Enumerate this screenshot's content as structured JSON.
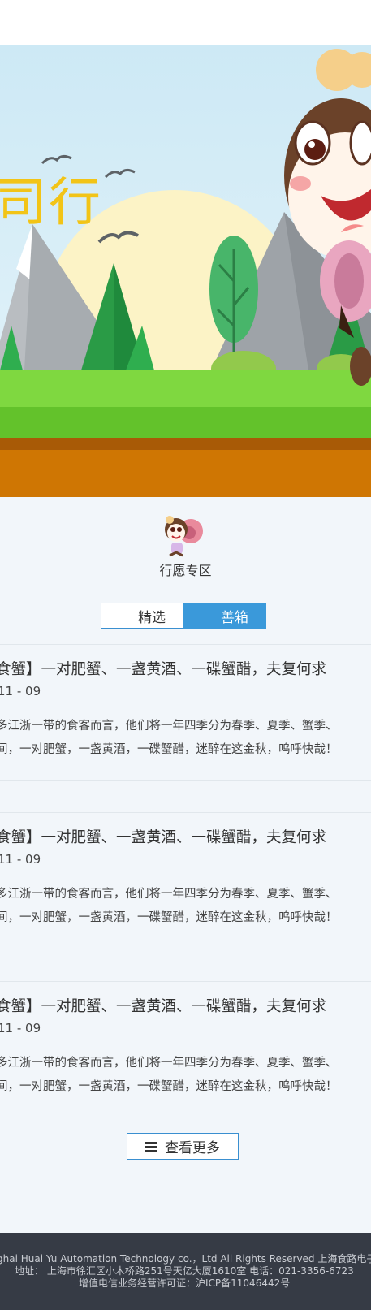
{
  "banner": {
    "text": "司行"
  },
  "zone": {
    "label": "行愿专区"
  },
  "tabs": [
    {
      "label": "精选",
      "active": false
    },
    {
      "label": "善箱",
      "active": true
    }
  ],
  "articles": [
    {
      "title": "食蟹】一对肥蟹、一盏黄酒、一碟蟹醋，夫复何求",
      "date": "11 - 09",
      "line1": "多江浙一带的食客而言，他们将一年四季分为春季、夏季、蟹季、",
      "line2": "间，一对肥蟹，一盏黄酒，一碟蟹醋，迷醉在这金秋，呜呼快哉！"
    },
    {
      "title": "食蟹】一对肥蟹、一盏黄酒、一碟蟹醋，夫复何求",
      "date": "11 - 09",
      "line1": "多江浙一带的食客而言，他们将一年四季分为春季、夏季、蟹季、",
      "line2": "间，一对肥蟹，一盏黄酒，一碟蟹醋，迷醉在这金秋，呜呼快哉！"
    },
    {
      "title": "食蟹】一对肥蟹、一盏黄酒、一碟蟹醋，夫复何求",
      "date": "11 - 09",
      "line1": "多江浙一带的食客而言，他们将一年四季分为春季、夏季、蟹季、",
      "line2": "间，一对肥蟹，一盏黄酒，一碟蟹醋，迷醉在这金秋，呜呼快哉！"
    }
  ],
  "more": {
    "label": "查看更多"
  },
  "footer": {
    "line1": "ghai Huai Yu Automation Technology co.，Ltd All Rights Reserved 上海食路电子商",
    "line2": "地址： 上海市徐汇区小木桥路251号天亿大厦1610室 电话：021-3356-6723",
    "line3": "增值电信业务经营许可证：沪ICP备11046442号"
  },
  "colors": {
    "accent": "#3a99da",
    "banner_text": "#f2c417",
    "footer_bg": "#363b45"
  },
  "icons": {
    "tab_icon": "menu-lines-icon",
    "more_icon": "menu-lines-icon"
  }
}
